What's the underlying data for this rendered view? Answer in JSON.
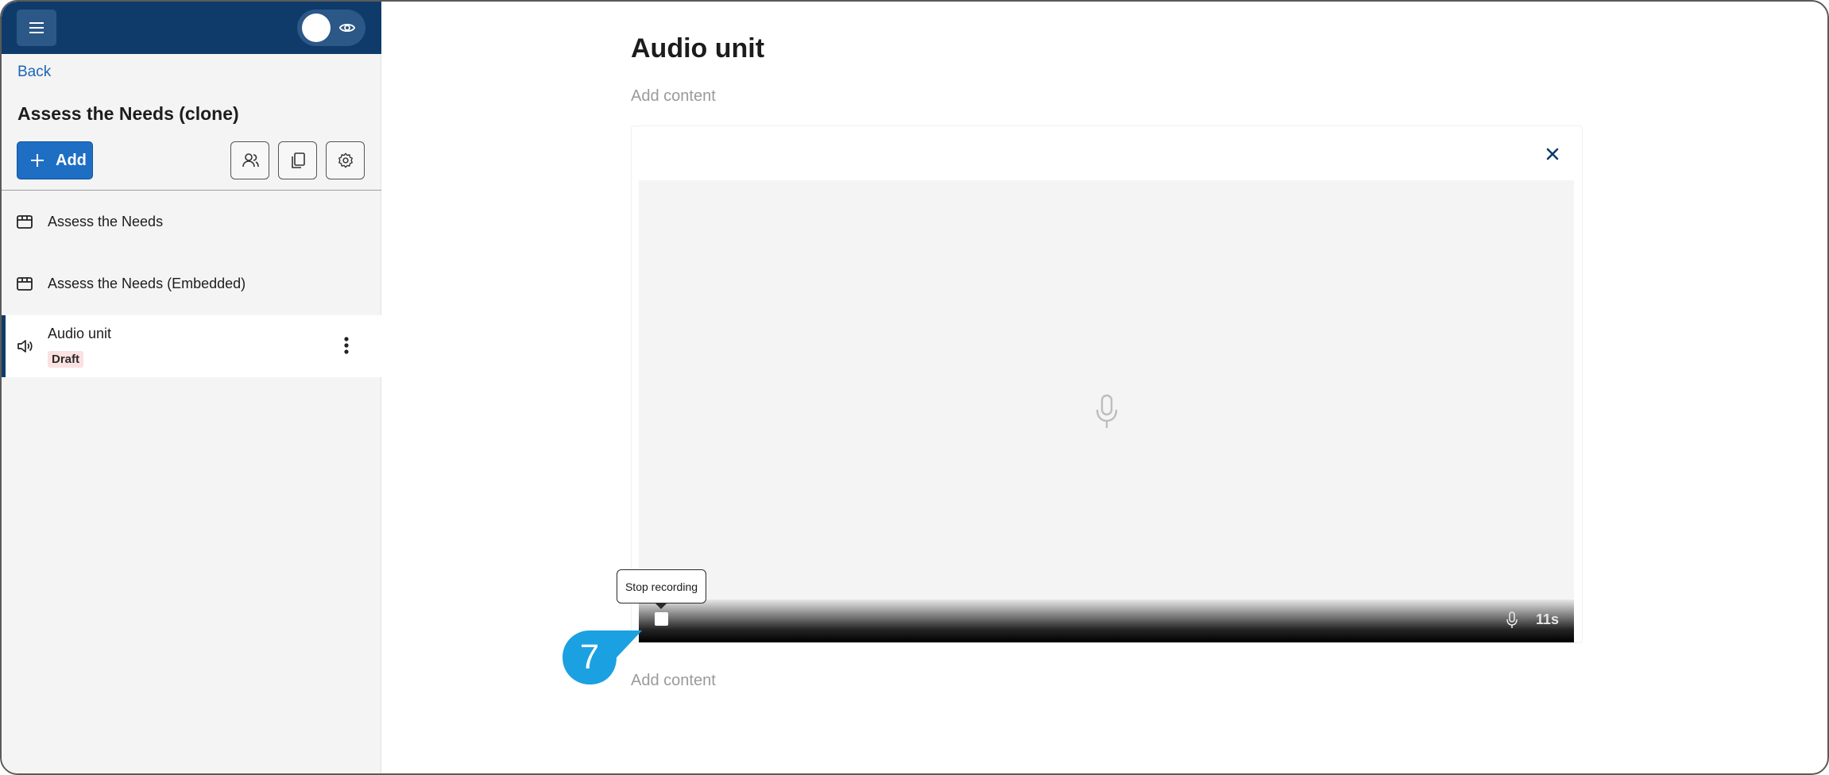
{
  "sidebar": {
    "back_label": "Back",
    "project_title": "Assess the Needs (clone)",
    "add_label": "Add",
    "tools": [
      {
        "name": "users-icon"
      },
      {
        "name": "copy-icon"
      },
      {
        "name": "gear-icon"
      }
    ],
    "items": [
      {
        "label": "Assess the Needs",
        "icon": "package-icon"
      },
      {
        "label": "Assess the Needs (Embedded)",
        "icon": "package-icon"
      },
      {
        "label": "Audio unit",
        "icon": "speaker-icon",
        "badge": "Draft",
        "active": true
      }
    ]
  },
  "main": {
    "title": "Audio unit",
    "add_content_top": "Add content",
    "add_content_bottom": "Add content",
    "recorder": {
      "tooltip": "Stop recording",
      "timer": "11s"
    }
  },
  "step_marker": "7",
  "colors": {
    "header": "#0f3b6b",
    "accent": "#1e6ec4",
    "marker": "#1ba1e2",
    "draft_badge": "#fbe1e1"
  }
}
